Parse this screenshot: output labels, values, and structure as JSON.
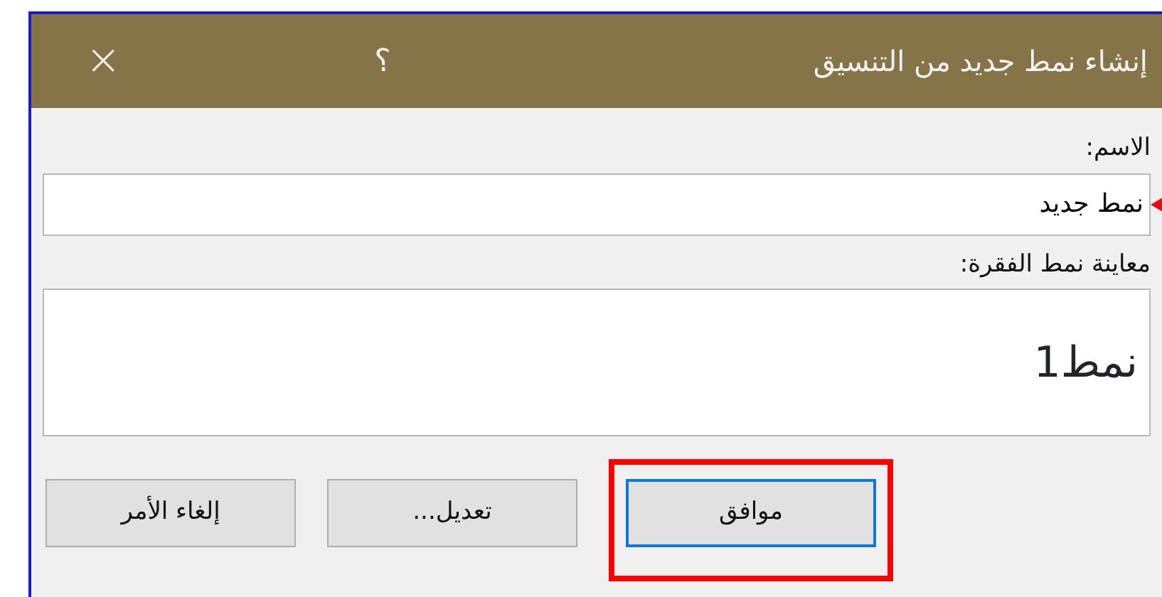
{
  "window": {
    "title": "إنشاء نمط جديد من التنسيق",
    "help": "؟",
    "close": "×"
  },
  "name_field": {
    "label": "الاسم:",
    "value": "نمط جديد",
    "pointer": true
  },
  "preview": {
    "label": "معاينة نمط الفقرة:",
    "text": "نمط1"
  },
  "buttons": [
    {
      "label": "موافق",
      "default": true,
      "highlighted": true
    },
    {
      "label": "تعديل...",
      "default": false,
      "highlighted": false
    },
    {
      "label": "إلغاء الأمر",
      "default": false,
      "highlighted": false
    }
  ]
}
